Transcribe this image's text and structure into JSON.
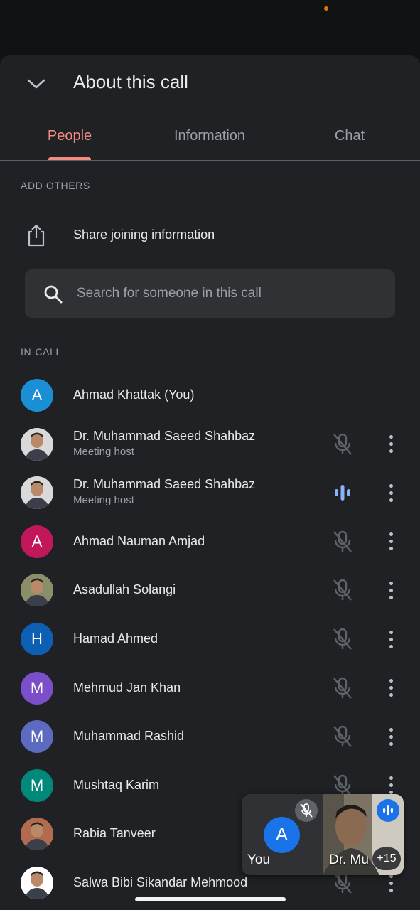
{
  "header": {
    "title": "About this call"
  },
  "tabs": [
    {
      "label": "People",
      "active": true
    },
    {
      "label": "Information",
      "active": false
    },
    {
      "label": "Chat",
      "active": false
    }
  ],
  "add_others": {
    "section_label": "ADD OTHERS",
    "share_label": "Share joining information",
    "share_icon": "share-icon"
  },
  "search": {
    "placeholder": "Search for someone in this call",
    "icon": "search-icon"
  },
  "in_call": {
    "section_label": "IN-CALL",
    "participants": [
      {
        "name": "Ahmad Khattak (You)",
        "role": "",
        "avatar_letter": "A",
        "avatar_color": "#1a8fd6",
        "photo": false,
        "mic": "none"
      },
      {
        "name": "Dr. Muhammad Saeed Shahbaz",
        "role": "Meeting host",
        "avatar_letter": "",
        "avatar_color": "#d9d9d9",
        "photo": true,
        "mic": "muted"
      },
      {
        "name": "Dr. Muhammad Saeed Shahbaz",
        "role": "Meeting host",
        "avatar_letter": "",
        "avatar_color": "#d9d9d9",
        "photo": true,
        "mic": "speaking"
      },
      {
        "name": "Ahmad Nauman Amjad",
        "role": "",
        "avatar_letter": "A",
        "avatar_color": "#c2185b",
        "photo": false,
        "mic": "muted"
      },
      {
        "name": "Asadullah Solangi",
        "role": "",
        "avatar_letter": "",
        "avatar_color": "#8a8f6a",
        "photo": true,
        "mic": "muted"
      },
      {
        "name": "Hamad Ahmed",
        "role": "",
        "avatar_letter": "H",
        "avatar_color": "#0d5fb3",
        "photo": false,
        "mic": "muted"
      },
      {
        "name": "Mehmud Jan Khan",
        "role": "",
        "avatar_letter": "M",
        "avatar_color": "#7b4fc9",
        "photo": false,
        "mic": "muted"
      },
      {
        "name": "Muhammad Rashid",
        "role": "",
        "avatar_letter": "M",
        "avatar_color": "#5c6bc0",
        "photo": false,
        "mic": "muted"
      },
      {
        "name": "Mushtaq Karim",
        "role": "",
        "avatar_letter": "M",
        "avatar_color": "#00897b",
        "photo": false,
        "mic": "muted"
      },
      {
        "name": "Rabia Tanveer",
        "role": "",
        "avatar_letter": "",
        "avatar_color": "#b36b4f",
        "photo": true,
        "mic": "muted"
      },
      {
        "name": "Salwa Bibi Sikandar Mehmood",
        "role": "",
        "avatar_letter": "",
        "avatar_color": "#ffffff",
        "photo": true,
        "mic": "muted"
      }
    ]
  },
  "pip": {
    "self_label": "You",
    "self_letter": "A",
    "self_color": "#1a73e8",
    "remote_label": "Dr. Mu",
    "overflow_count": "+15"
  },
  "colors": {
    "sheet_bg": "#202124",
    "accent_tab": "#f28b82",
    "speaking_blue": "#8ab4f8",
    "muted_icon": "#5f6368"
  }
}
